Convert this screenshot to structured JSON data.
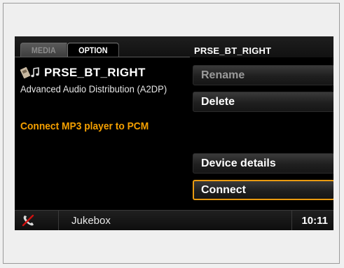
{
  "tabs": {
    "media_label": "MEDIA",
    "option_label": "OPTION"
  },
  "header": {
    "device_title": "PRSE_BT_RIGHT"
  },
  "device": {
    "icon": "bluetooth-audio-icon",
    "name": "PRSE_BT_RIGHT",
    "profile": "Advanced Audio Distribution (A2DP)"
  },
  "hint": {
    "text": "Connect MP3 player to PCM"
  },
  "menu": {
    "rename_label": "Rename",
    "delete_label": "Delete",
    "details_label": "Device details",
    "connect_label": "Connect"
  },
  "status": {
    "phone_icon": "phone-off-icon",
    "source": "Jukebox",
    "time": "10:11"
  },
  "colors": {
    "accent": "#f5a000",
    "background": "#000000",
    "text": "#ffffff",
    "disabled_text": "#9a9a9a"
  }
}
